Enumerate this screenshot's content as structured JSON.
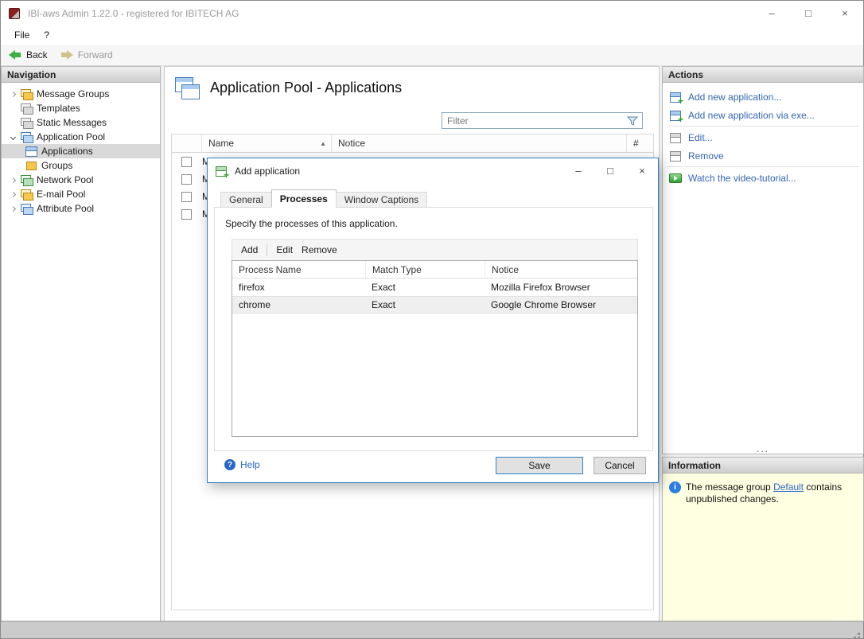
{
  "window": {
    "title": "IBI-aws Admin 1.22.0 - registered for IBITECH AG",
    "controls": {
      "minimize": "–",
      "maximize": "□",
      "close": "×"
    }
  },
  "menu": {
    "file": "File",
    "help": "?"
  },
  "toolbar": {
    "back": "Back",
    "forward": "Forward"
  },
  "navigation": {
    "header": "Navigation",
    "items": [
      {
        "label": "Message Groups"
      },
      {
        "label": "Templates"
      },
      {
        "label": "Static Messages"
      },
      {
        "label": "Application Pool"
      },
      {
        "label": "Applications"
      },
      {
        "label": "Groups"
      },
      {
        "label": "Network Pool"
      },
      {
        "label": "E-mail Pool"
      },
      {
        "label": "Attribute Pool"
      }
    ]
  },
  "main": {
    "title": "Application Pool - Applications",
    "filter": {
      "placeholder": "Filter"
    },
    "table": {
      "columns": {
        "name": "Name",
        "notice": "Notice",
        "count": "#"
      },
      "sort_indicator": "▲",
      "rows": [
        {
          "name": "M"
        },
        {
          "name": "M"
        },
        {
          "name": "M"
        },
        {
          "name": "M"
        }
      ]
    }
  },
  "dialog": {
    "title": "Add application",
    "controls": {
      "minimize": "–",
      "maximize": "□",
      "close": "×"
    },
    "tabs": {
      "general": "General",
      "processes": "Processes",
      "window_captions": "Window Captions"
    },
    "active_tab": "Processes",
    "description": "Specify the processes of this application.",
    "toolbar": {
      "add": "Add",
      "edit": "Edit",
      "remove": "Remove"
    },
    "table": {
      "columns": {
        "process_name": "Process Name",
        "match_type": "Match Type",
        "notice": "Notice"
      },
      "rows": [
        {
          "process_name": "firefox",
          "match_type": "Exact",
          "notice": "Mozilla Firefox Browser"
        },
        {
          "process_name": "chrome",
          "match_type": "Exact",
          "notice": "Google Chrome Browser"
        }
      ]
    },
    "help": "Help",
    "buttons": {
      "save": "Save",
      "cancel": "Cancel"
    }
  },
  "actions": {
    "header": "Actions",
    "items": [
      {
        "label": "Add new application..."
      },
      {
        "label": "Add new application via exe..."
      },
      {
        "label": "Edit..."
      },
      {
        "label": "Remove"
      },
      {
        "label": "Watch the video-tutorial..."
      }
    ],
    "overflow": "..."
  },
  "information": {
    "header": "Information",
    "text_before": "The message group ",
    "link": "Default",
    "text_after": " contains unpublished changes."
  },
  "icons": {
    "filter": "funnel-icon",
    "back": "green-left-arrow",
    "forward": "gray-right-arrow",
    "help": "question-circle",
    "info": "info-circle"
  }
}
